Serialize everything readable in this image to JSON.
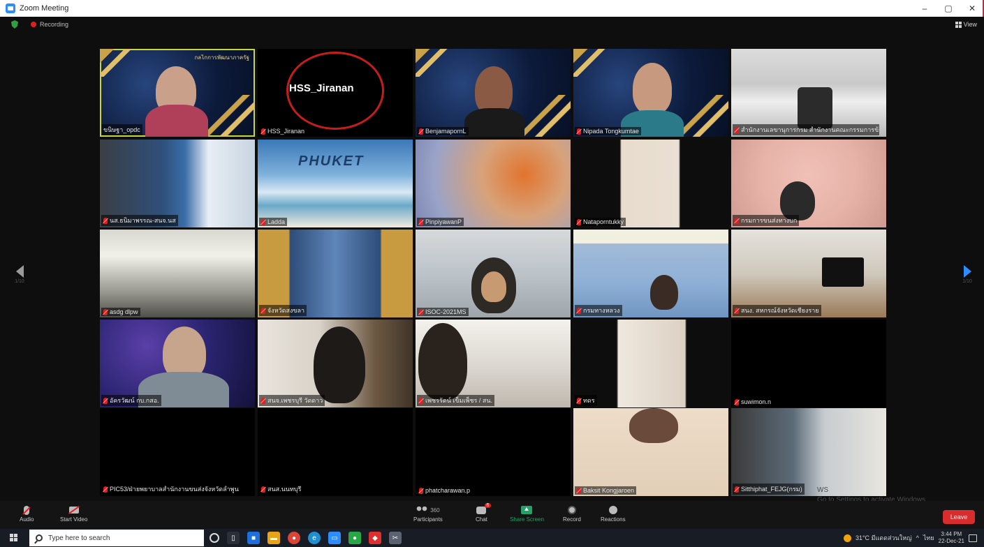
{
  "window": {
    "title": "Zoom Meeting",
    "controls": [
      "–",
      "▢",
      "✕"
    ]
  },
  "top": {
    "recording_label": "Recording",
    "view_label": "View"
  },
  "pager": {
    "left": "1/10",
    "right": "1/10"
  },
  "annotation": {
    "circled_name": "HSS_Jiranan"
  },
  "tiles": [
    {
      "name": "ขนิษฐา_opdc"
    },
    {
      "name": "HSS_Jiranan"
    },
    {
      "name": "BenjamapornL"
    },
    {
      "name": "Nipada Tongkumtae"
    },
    {
      "name": "สำนักงานเลขานุการกรม สำนักงานคณะกรรมการข้าราช..."
    },
    {
      "name": "นส.ธนิมาพรรณ-สนจ.นส"
    },
    {
      "name": "Ladda"
    },
    {
      "name": "PinpiyawanP"
    },
    {
      "name": "Nataporntukky"
    },
    {
      "name": "กรมการขนส่งทางบก"
    },
    {
      "name": "asdg dlpw"
    },
    {
      "name": "จังหวัดสงขลา"
    },
    {
      "name": "ISOC-2021MS"
    },
    {
      "name": "กรมทางหลวง"
    },
    {
      "name": "สนง. สหกรณ์จังหวัดเชียงราย"
    },
    {
      "name": "อัครวัฒน์ กบ.กสอ."
    },
    {
      "name": "สนจ.เพชรบุรี วัดดาว"
    },
    {
      "name": "เพชรรัตน์ เข็มเพ็ชร / สน."
    },
    {
      "name": "ทดร"
    },
    {
      "name": "suwimon.n"
    },
    {
      "name": "PIC53/ฝ่ายพยาบาลสำนักงานขนส่งจังหวัดลำพูน"
    },
    {
      "name": "สนส.นนทบุรี"
    },
    {
      "name": "phatcharawan.p"
    },
    {
      "name": "Baksit Kongjaroen"
    },
    {
      "name": "Sitthiphat_FEJG(กรม)"
    }
  ],
  "tile_text": {
    "phuket": "PHUKET",
    "poster_header": "กลไกการพัฒนาภาครัฐ"
  },
  "toolbar": {
    "audio": "Audio",
    "start_video": "Start Video",
    "participants": "Participants",
    "participants_count": "360",
    "chat": "Chat",
    "chat_badge": "6",
    "share_screen": "Share Screen",
    "record": "Record",
    "reactions": "Reactions",
    "leave": "Leave"
  },
  "watermark": {
    "line1": "WS",
    "line2": "Go to Settings to activate Windows"
  },
  "taskbar": {
    "search_placeholder": "Type here to search",
    "weather": "31°C มีแดดส่วนใหญ่",
    "lang": "ไทย",
    "time": "3:44 PM",
    "date": "22-Dec-21"
  },
  "colors": {
    "active_speaker": "#c7d63b",
    "leave": "#d92c2c",
    "zoom_blue": "#2d8cff",
    "annotation": "#c51d1d"
  }
}
